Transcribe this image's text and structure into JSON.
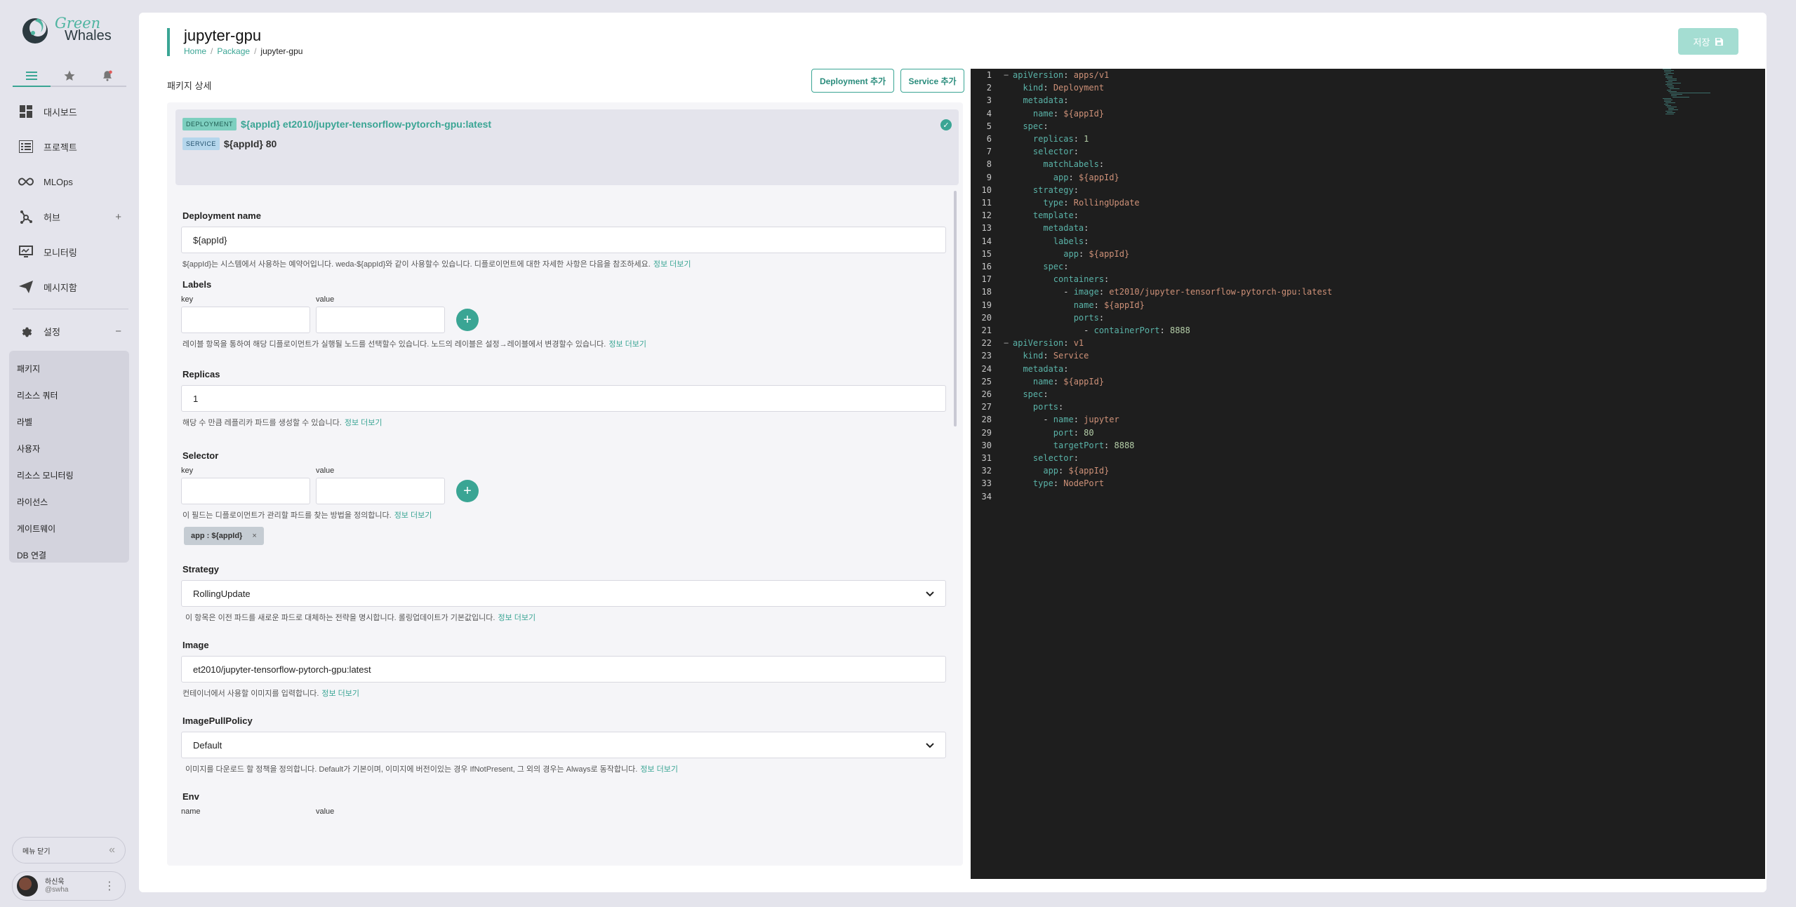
{
  "brand": {
    "line1": "Green",
    "line2": "Whales",
    "accent": "#3aa594"
  },
  "sidebar": {
    "tabs": [
      {
        "name": "menu-list-icon"
      },
      {
        "name": "star-icon"
      },
      {
        "name": "bell-icon"
      }
    ],
    "items": [
      {
        "label": "대시보드",
        "icon": "dashboard-icon"
      },
      {
        "label": "프로젝트",
        "icon": "list-icon"
      },
      {
        "label": "MLOps",
        "icon": "infinity-icon"
      },
      {
        "label": "허브",
        "icon": "hub-icon",
        "aux": "+"
      },
      {
        "label": "모니터링",
        "icon": "monitor-icon"
      },
      {
        "label": "메시지함",
        "icon": "send-icon"
      },
      {
        "label": "설정",
        "icon": "gear-icon",
        "aux": "−"
      }
    ],
    "sub_items": [
      "패키지",
      "리소스 쿼터",
      "라벨",
      "사용자",
      "리소스 모니터링",
      "라이선스",
      "게이트웨이",
      "DB 연결"
    ],
    "menu_close": "메뉴 닫기",
    "user": {
      "name": "하신욱",
      "handle": "@swha"
    }
  },
  "header": {
    "title": "jupyter-gpu",
    "breadcrumb": [
      "Home",
      "Package",
      "jupyter-gpu"
    ],
    "save_label": "저장"
  },
  "package": {
    "section_label": "패키지 상세",
    "add_deployment": "Deployment 추가",
    "add_service": "Service 추가",
    "summary": {
      "deployment_tag": "DEPLOYMENT",
      "deployment_text": "${appId} et2010/jupyter-tensorflow-pytorch-gpu:latest",
      "service_tag": "SERVICE",
      "service_text": "${appId} 80"
    }
  },
  "form": {
    "more": "정보 더보기",
    "key_label": "key",
    "value_label": "value",
    "name_label": "name",
    "deployment_name": {
      "label": "Deployment name",
      "value": "${appId}",
      "help": "${appId}는 시스템에서 사용하는 예약어입니다. weda-${appId}와 같이 사용할수 있습니다. 디플로이먼트에 대한 자세한 사항은 다음을 참조하세요."
    },
    "labels": {
      "label": "Labels",
      "help": "레이블 항목을 통하여 해당 디플로이먼트가 실행될 노드를 선택할수 있습니다. 노드의 레이블은 설정→레이블에서 변경할수 있습니다."
    },
    "replicas": {
      "label": "Replicas",
      "value": "1",
      "help": "해당 수 만큼 레플리카 파드를 생성할 수 있습니다."
    },
    "selector": {
      "label": "Selector",
      "help": "이 필드는 디플로이먼트가 관리할 파드를 찾는 방법을 정의합니다.",
      "chip": "app : ${appId}"
    },
    "strategy": {
      "label": "Strategy",
      "value": "RollingUpdate",
      "help": "이 항목은 이전 파드를 새로운 파드로 대체하는 전략을 명시합니다. 롤링업데이트가 기본값입니다."
    },
    "image": {
      "label": "Image",
      "value": "et2010/jupyter-tensorflow-pytorch-gpu:latest",
      "help": "컨테이너에서 사용할 이미지를 입력합니다."
    },
    "image_pull_policy": {
      "label": "ImagePullPolicy",
      "value": "Default",
      "help": "이미지를 다운로드 할 정책을 정의합니다. Default가 기본이며, 이미지에 버전이있는 경우 IfNotPresent, 그 외의 경우는 Always로 동작합니다."
    },
    "env": {
      "label": "Env"
    }
  },
  "yaml": [
    {
      "n": "1",
      "fold": "−",
      "t": [
        [
          "k",
          "apiVersion"
        ],
        [
          "p",
          ": "
        ],
        [
          "v",
          "apps/v1"
        ]
      ]
    },
    {
      "n": "2",
      "t": [
        [
          "p",
          "  "
        ],
        [
          "k",
          "kind"
        ],
        [
          "p",
          ": "
        ],
        [
          "v",
          "Deployment"
        ]
      ]
    },
    {
      "n": "3",
      "t": [
        [
          "p",
          "  "
        ],
        [
          "k",
          "metadata"
        ],
        [
          "p",
          ":"
        ]
      ]
    },
    {
      "n": "4",
      "t": [
        [
          "p",
          "    "
        ],
        [
          "k",
          "name"
        ],
        [
          "p",
          ": "
        ],
        [
          "v",
          "${appId}"
        ]
      ]
    },
    {
      "n": "5",
      "t": [
        [
          "p",
          "  "
        ],
        [
          "k",
          "spec"
        ],
        [
          "p",
          ":"
        ]
      ]
    },
    {
      "n": "6",
      "t": [
        [
          "p",
          "    "
        ],
        [
          "k",
          "replicas"
        ],
        [
          "p",
          ": "
        ],
        [
          "n",
          "1"
        ]
      ]
    },
    {
      "n": "7",
      "t": [
        [
          "p",
          "    "
        ],
        [
          "k",
          "selector"
        ],
        [
          "p",
          ":"
        ]
      ]
    },
    {
      "n": "8",
      "t": [
        [
          "p",
          "      "
        ],
        [
          "k",
          "matchLabels"
        ],
        [
          "p",
          ":"
        ]
      ]
    },
    {
      "n": "9",
      "t": [
        [
          "p",
          "        "
        ],
        [
          "k",
          "app"
        ],
        [
          "p",
          ": "
        ],
        [
          "v",
          "${appId}"
        ]
      ]
    },
    {
      "n": "10",
      "t": [
        [
          "p",
          "    "
        ],
        [
          "k",
          "strategy"
        ],
        [
          "p",
          ":"
        ]
      ]
    },
    {
      "n": "11",
      "t": [
        [
          "p",
          "      "
        ],
        [
          "k",
          "type"
        ],
        [
          "p",
          ": "
        ],
        [
          "v",
          "RollingUpdate"
        ]
      ]
    },
    {
      "n": "12",
      "t": [
        [
          "p",
          "    "
        ],
        [
          "k",
          "template"
        ],
        [
          "p",
          ":"
        ]
      ]
    },
    {
      "n": "13",
      "t": [
        [
          "p",
          "      "
        ],
        [
          "k",
          "metadata"
        ],
        [
          "p",
          ":"
        ]
      ]
    },
    {
      "n": "14",
      "t": [
        [
          "p",
          "        "
        ],
        [
          "k",
          "labels"
        ],
        [
          "p",
          ":"
        ]
      ]
    },
    {
      "n": "15",
      "t": [
        [
          "p",
          "          "
        ],
        [
          "k",
          "app"
        ],
        [
          "p",
          ": "
        ],
        [
          "v",
          "${appId}"
        ]
      ]
    },
    {
      "n": "16",
      "t": [
        [
          "p",
          "      "
        ],
        [
          "k",
          "spec"
        ],
        [
          "p",
          ":"
        ]
      ]
    },
    {
      "n": "17",
      "t": [
        [
          "p",
          "        "
        ],
        [
          "k",
          "containers"
        ],
        [
          "p",
          ":"
        ]
      ]
    },
    {
      "n": "18",
      "t": [
        [
          "p",
          "          - "
        ],
        [
          "k",
          "image"
        ],
        [
          "p",
          ": "
        ],
        [
          "v",
          "et2010/jupyter-tensorflow-pytorch-gpu:latest"
        ]
      ]
    },
    {
      "n": "19",
      "t": [
        [
          "p",
          "            "
        ],
        [
          "k",
          "name"
        ],
        [
          "p",
          ": "
        ],
        [
          "v",
          "${appId}"
        ]
      ]
    },
    {
      "n": "20",
      "t": [
        [
          "p",
          "            "
        ],
        [
          "k",
          "ports"
        ],
        [
          "p",
          ":"
        ]
      ]
    },
    {
      "n": "21",
      "t": [
        [
          "p",
          "              - "
        ],
        [
          "k",
          "containerPort"
        ],
        [
          "p",
          ": "
        ],
        [
          "n",
          "8888"
        ]
      ]
    },
    {
      "n": "22",
      "fold": "−",
      "t": [
        [
          "k",
          "apiVersion"
        ],
        [
          "p",
          ": "
        ],
        [
          "v",
          "v1"
        ]
      ]
    },
    {
      "n": "23",
      "t": [
        [
          "p",
          "  "
        ],
        [
          "k",
          "kind"
        ],
        [
          "p",
          ": "
        ],
        [
          "v",
          "Service"
        ]
      ]
    },
    {
      "n": "24",
      "t": [
        [
          "p",
          "  "
        ],
        [
          "k",
          "metadata"
        ],
        [
          "p",
          ":"
        ]
      ]
    },
    {
      "n": "25",
      "t": [
        [
          "p",
          "    "
        ],
        [
          "k",
          "name"
        ],
        [
          "p",
          ": "
        ],
        [
          "v",
          "${appId}"
        ]
      ]
    },
    {
      "n": "26",
      "t": [
        [
          "p",
          "  "
        ],
        [
          "k",
          "spec"
        ],
        [
          "p",
          ":"
        ]
      ]
    },
    {
      "n": "27",
      "t": [
        [
          "p",
          "    "
        ],
        [
          "k",
          "ports"
        ],
        [
          "p",
          ":"
        ]
      ]
    },
    {
      "n": "28",
      "t": [
        [
          "p",
          "      - "
        ],
        [
          "k",
          "name"
        ],
        [
          "p",
          ": "
        ],
        [
          "v",
          "jupyter"
        ]
      ]
    },
    {
      "n": "29",
      "t": [
        [
          "p",
          "        "
        ],
        [
          "k",
          "port"
        ],
        [
          "p",
          ": "
        ],
        [
          "n",
          "80"
        ]
      ]
    },
    {
      "n": "30",
      "t": [
        [
          "p",
          "        "
        ],
        [
          "k",
          "targetPort"
        ],
        [
          "p",
          ": "
        ],
        [
          "n",
          "8888"
        ]
      ]
    },
    {
      "n": "31",
      "t": [
        [
          "p",
          "    "
        ],
        [
          "k",
          "selector"
        ],
        [
          "p",
          ":"
        ]
      ]
    },
    {
      "n": "32",
      "t": [
        [
          "p",
          "      "
        ],
        [
          "k",
          "app"
        ],
        [
          "p",
          ": "
        ],
        [
          "v",
          "${appId}"
        ]
      ]
    },
    {
      "n": "33",
      "t": [
        [
          "p",
          "    "
        ],
        [
          "k",
          "type"
        ],
        [
          "p",
          ": "
        ],
        [
          "v",
          "NodePort"
        ]
      ]
    },
    {
      "n": "34",
      "t": []
    }
  ]
}
